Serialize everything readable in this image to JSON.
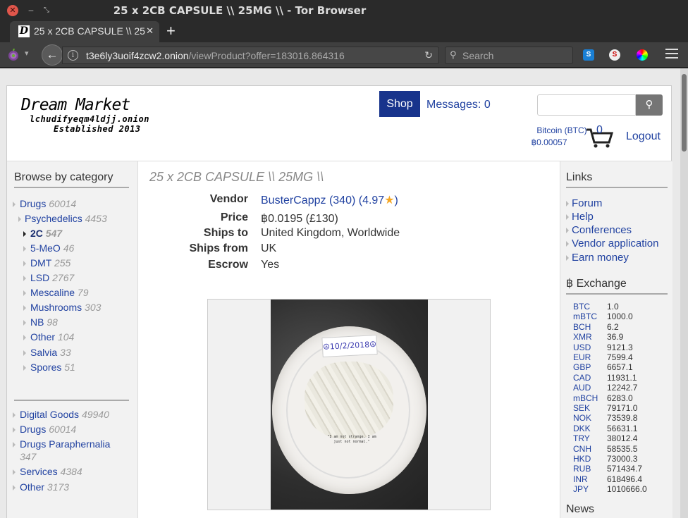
{
  "window": {
    "title": "25 x 2CB CAPSULE \\\\ 25MG \\\\ - Tor Browser"
  },
  "tab": {
    "title": "25 x 2CB CAPSULE \\\\ 25MG \\\\",
    "favicon": "D"
  },
  "nav": {
    "url_host": "t3e6ly3uoif4zcw2.onion",
    "url_path": "/viewProduct?offer=183016.864316",
    "search_placeholder": "Search"
  },
  "header": {
    "logo_title": "Dream Market",
    "logo_onion": "lchudifyeqm4ldjj.onion",
    "logo_established": "Established 2013",
    "shop_label": "Shop",
    "messages_label": "Messages: 0",
    "btc_label": "Bitcoin (BTC)",
    "btc_balance": "฿0.00057",
    "cart_count": "0",
    "logout_label": "Logout"
  },
  "left_sidebar": {
    "title": "Browse by category",
    "tree": [
      {
        "name": "Drugs",
        "count": "60014"
      },
      {
        "name": "Psychedelics",
        "count": "4453"
      },
      {
        "name": "2C",
        "count": "547",
        "active": true
      },
      {
        "name": "5-MeO",
        "count": "46"
      },
      {
        "name": "DMT",
        "count": "255"
      },
      {
        "name": "LSD",
        "count": "2767"
      },
      {
        "name": "Mescaline",
        "count": "79"
      },
      {
        "name": "Mushrooms",
        "count": "303"
      },
      {
        "name": "NB",
        "count": "98"
      },
      {
        "name": "Other",
        "count": "104"
      },
      {
        "name": "Salvia",
        "count": "33"
      },
      {
        "name": "Spores",
        "count": "51"
      }
    ],
    "top": [
      {
        "name": "Digital Goods",
        "count": "49940"
      },
      {
        "name": "Drugs",
        "count": "60014"
      },
      {
        "name": "Drugs Paraphernalia",
        "count": "347"
      },
      {
        "name": "Services",
        "count": "4384"
      },
      {
        "name": "Other",
        "count": "3173"
      }
    ]
  },
  "product": {
    "title": "25 x 2CB CAPSULE \\\\ 25MG \\\\",
    "vendor_label": "Vendor",
    "vendor_value": "BusterCappz (340) (4.97",
    "vendor_suffix": ")",
    "price_label": "Price",
    "price_value": "฿0.0195 (£130)",
    "ships_to_label": "Ships to",
    "ships_to_value": "United Kingdom, Worldwide",
    "ships_from_label": "Ships from",
    "ships_from_value": "UK",
    "escrow_label": "Escrow",
    "escrow_value": "Yes",
    "photo_note": "☮10/2/2018☮",
    "photo_quote": "\"I am not strange. I am just not normal.\""
  },
  "right_sidebar": {
    "links_title": "Links",
    "links": [
      "Forum",
      "Help",
      "Conferences",
      "Vendor application",
      "Earn money"
    ],
    "exchange_title": "฿ Exchange",
    "rates": [
      {
        "code": "BTC",
        "value": "1.0"
      },
      {
        "code": "mBTC",
        "value": "1000.0"
      },
      {
        "code": "BCH",
        "value": "6.2"
      },
      {
        "code": "XMR",
        "value": "36.9"
      },
      {
        "code": "USD",
        "value": "9121.3"
      },
      {
        "code": "EUR",
        "value": "7599.4"
      },
      {
        "code": "GBP",
        "value": "6657.1"
      },
      {
        "code": "CAD",
        "value": "11931.1"
      },
      {
        "code": "AUD",
        "value": "12242.7"
      },
      {
        "code": "mBCH",
        "value": "6283.0"
      },
      {
        "code": "SEK",
        "value": "79171.0"
      },
      {
        "code": "NOK",
        "value": "73539.8"
      },
      {
        "code": "DKK",
        "value": "56631.1"
      },
      {
        "code": "TRY",
        "value": "38012.4"
      },
      {
        "code": "CNH",
        "value": "58535.5"
      },
      {
        "code": "HKD",
        "value": "73000.3"
      },
      {
        "code": "RUB",
        "value": "571434.7"
      },
      {
        "code": "INR",
        "value": "618496.4"
      },
      {
        "code": "JPY",
        "value": "1010666.0"
      }
    ],
    "news_title": "News"
  },
  "colors": {
    "link": "#2142a1",
    "shop_button": "#18348c",
    "close_button": "#e0564b"
  }
}
